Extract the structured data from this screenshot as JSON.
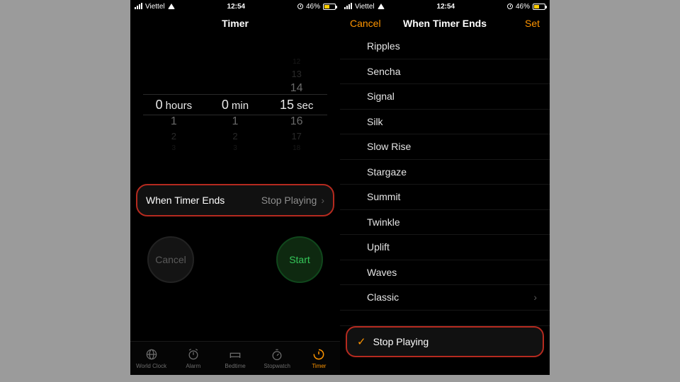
{
  "status": {
    "carrier": "Viettel",
    "time": "12:54",
    "battery_pct": "46%"
  },
  "left_screen": {
    "nav_title": "Timer",
    "picker": {
      "hours_value": "0",
      "hours_label": "hours",
      "mins_value": "0",
      "mins_label": "min",
      "secs_value": "15",
      "secs_label": "sec",
      "hours_below1": "1",
      "hours_below2": "2",
      "hours_below3": "3",
      "mins_below1": "1",
      "mins_below2": "2",
      "mins_below3": "3",
      "secs_above3": "12",
      "secs_above2": "13",
      "secs_above1": "14",
      "secs_below1": "16",
      "secs_below2": "17",
      "secs_below3": "18"
    },
    "wte_label": "When Timer Ends",
    "wte_value": "Stop Playing",
    "cancel_label": "Cancel",
    "start_label": "Start",
    "tabs": {
      "world": "World Clock",
      "alarm": "Alarm",
      "bedtime": "Bedtime",
      "stopwatch": "Stopwatch",
      "timer": "Timer"
    }
  },
  "right_screen": {
    "nav_cancel": "Cancel",
    "nav_title": "When Timer Ends",
    "nav_set": "Set",
    "sounds": {
      "i0": "Ripples",
      "i1": "Sencha",
      "i2": "Signal",
      "i3": "Silk",
      "i4": "Slow Rise",
      "i5": "Stargaze",
      "i6": "Summit",
      "i7": "Twinkle",
      "i8": "Uplift",
      "i9": "Waves",
      "i10": "Classic"
    },
    "stop_playing": "Stop Playing"
  }
}
